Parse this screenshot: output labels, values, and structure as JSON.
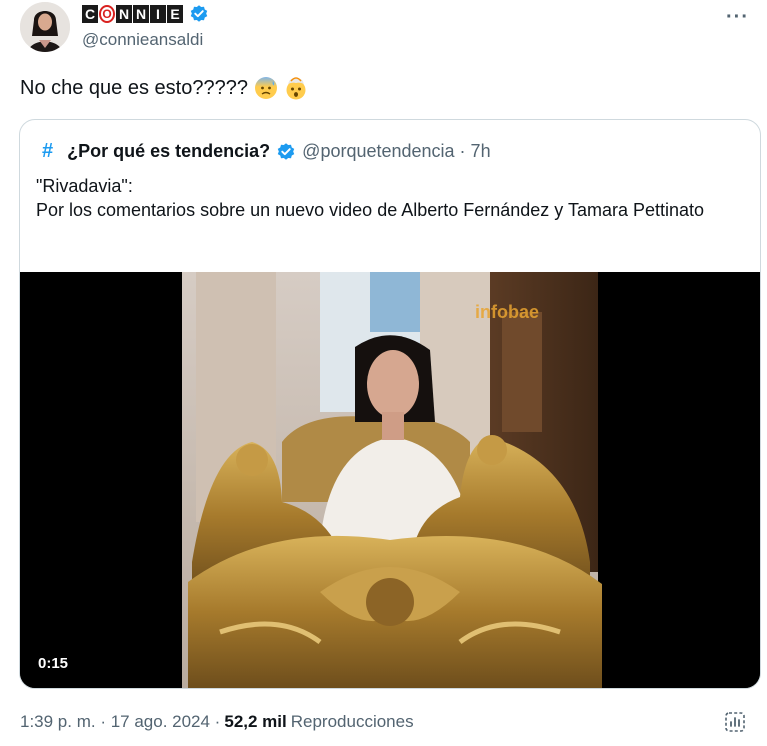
{
  "author": {
    "display_name_letters": [
      "C",
      "O",
      "N",
      "N",
      "I",
      "E"
    ],
    "handle": "@connieansaldi",
    "verified": true,
    "avatar": "profile-photo"
  },
  "more_icon": "more-options-icon",
  "tweet": {
    "text": "No che que es esto?????",
    "emojis": [
      "anxious-face-with-sweat-emoji",
      "exploding-head-emoji"
    ]
  },
  "quote": {
    "hash_icon": "#",
    "name": "¿Por qué es tendencia?",
    "verified": true,
    "handle_time": "@porquetendencia · 7h",
    "line1": "\"Rivadavia\":",
    "line2": "Por los comentarios sobre un nuevo video de Alberto Fernández y Tamara Pettinato",
    "video": {
      "duration": "0:15",
      "watermark": "infobae"
    }
  },
  "footer": {
    "time_date": "1:39 p. m. · 17 ago. 2024 ·",
    "views_count": "52,2 mil",
    "views_label": "Reproducciones",
    "analytics_icon": "analytics-icon"
  },
  "colors": {
    "accent": "#1d9bf0",
    "text": "#0f1419",
    "secondary": "#536471",
    "border": "#cfd9de"
  }
}
